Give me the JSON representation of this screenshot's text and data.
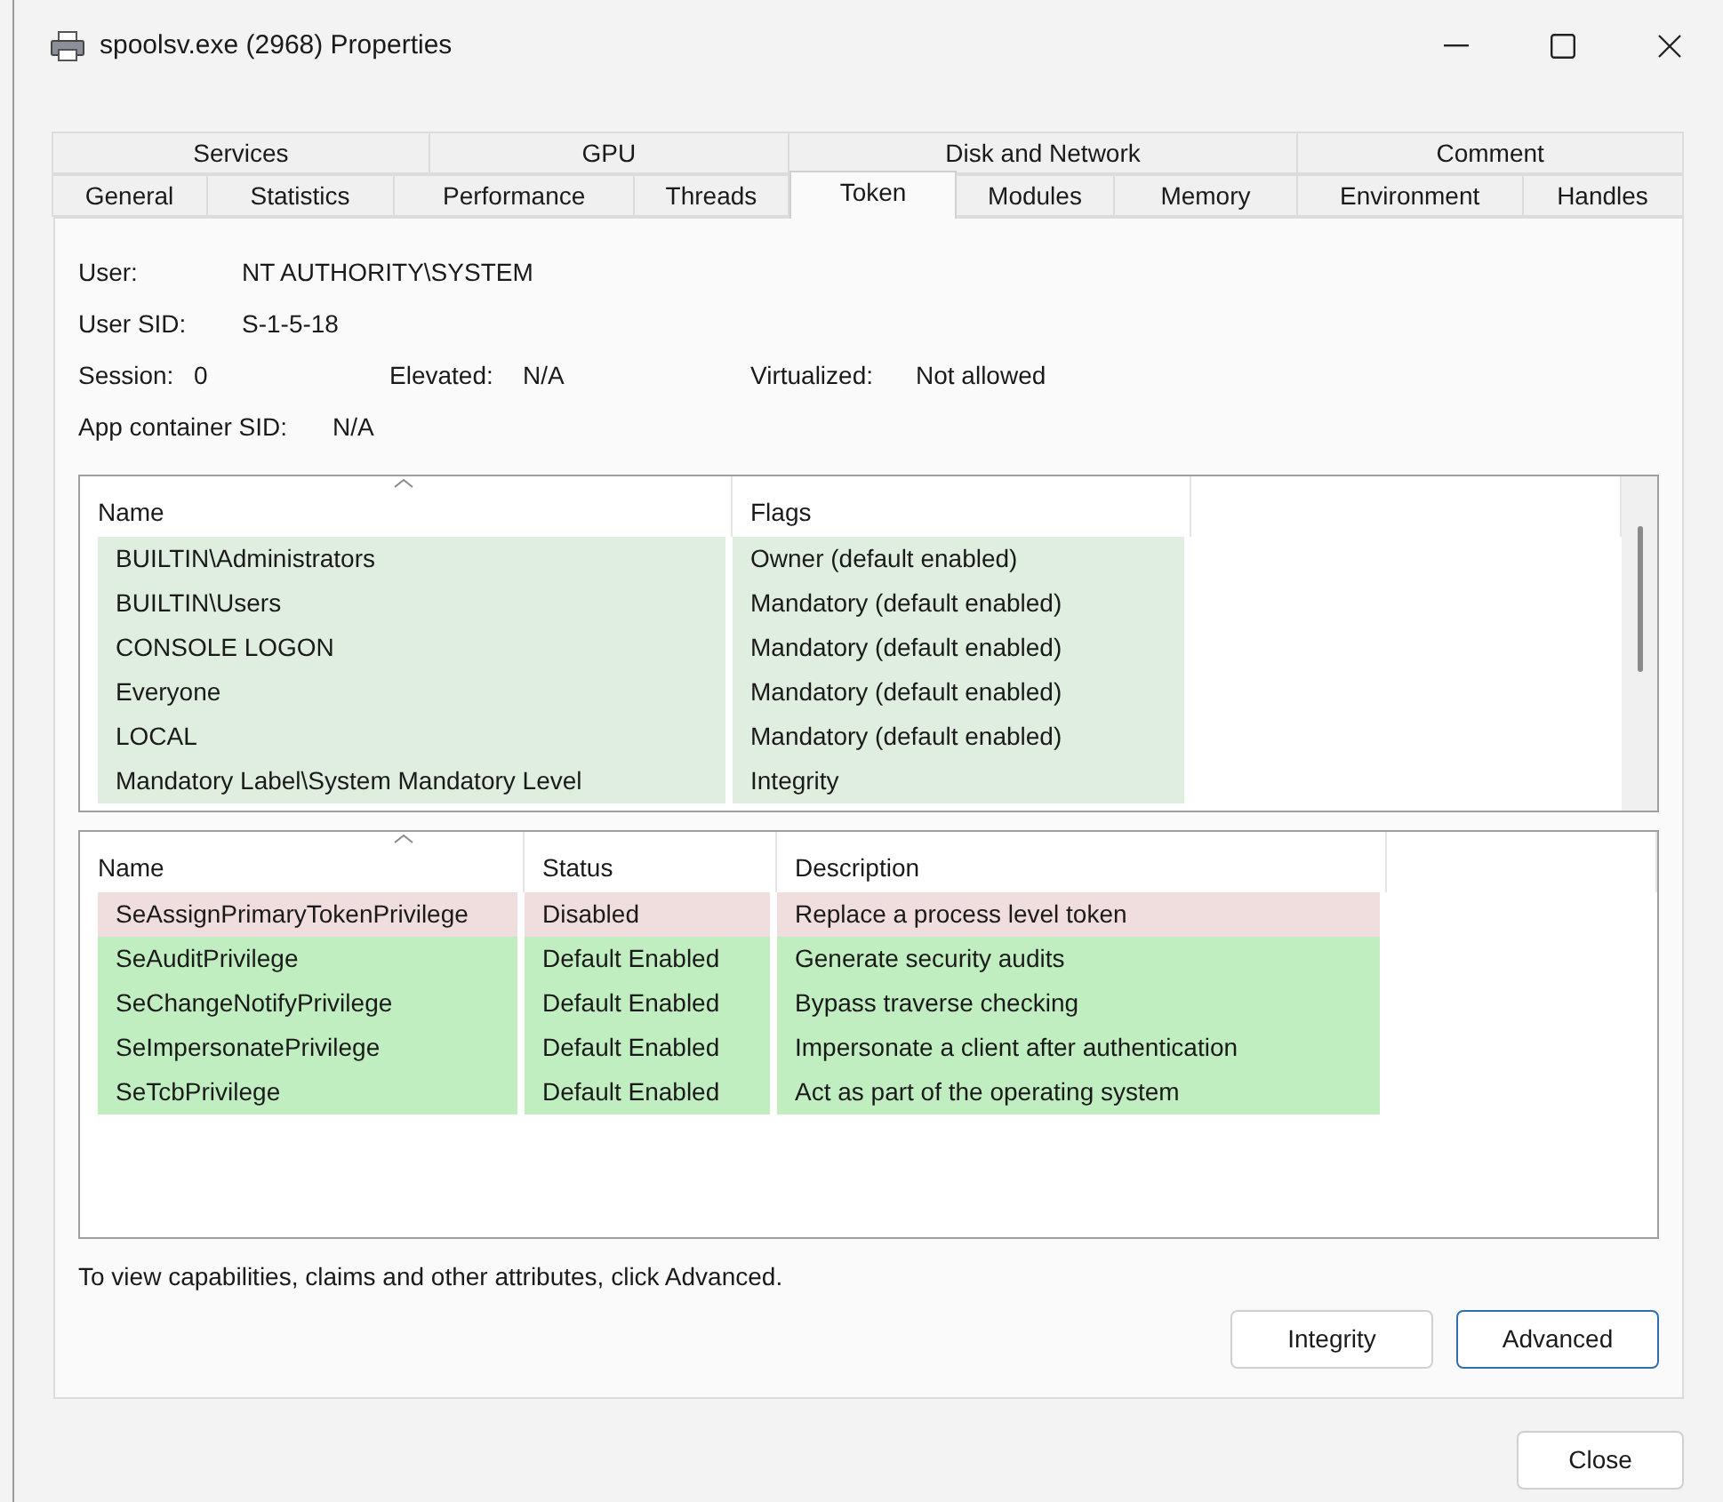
{
  "window": {
    "title": "spoolsv.exe (2968) Properties"
  },
  "tab_rows": [
    [
      {
        "label": "Services",
        "selected": false
      },
      {
        "label": "GPU",
        "selected": false
      },
      {
        "label": "Disk and Network",
        "selected": false
      },
      {
        "label": "Comment",
        "selected": false
      }
    ],
    [
      {
        "label": "General",
        "selected": false
      },
      {
        "label": "Statistics",
        "selected": false
      },
      {
        "label": "Performance",
        "selected": false
      },
      {
        "label": "Threads",
        "selected": false
      },
      {
        "label": "Token",
        "selected": true
      },
      {
        "label": "Modules",
        "selected": false
      },
      {
        "label": "Memory",
        "selected": false
      },
      {
        "label": "Environment",
        "selected": false
      },
      {
        "label": "Handles",
        "selected": false
      }
    ]
  ],
  "info": {
    "user_label": "User:",
    "user": "NT AUTHORITY\\SYSTEM",
    "sid_label": "User SID:",
    "sid": "S-1-5-18",
    "session_label": "Session:",
    "session": "0",
    "elevated_label": "Elevated:",
    "elevated": "N/A",
    "virtualized_label": "Virtualized:",
    "virtualized": "Not allowed",
    "app_container_label": "App container SID:",
    "app_container": "N/A"
  },
  "groups": {
    "columns": [
      "Name",
      "Flags"
    ],
    "rows": [
      {
        "name": "BUILTIN\\Administrators",
        "flags": "Owner (default enabled)",
        "color": "#dfeedf"
      },
      {
        "name": "BUILTIN\\Users",
        "flags": "Mandatory (default enabled)",
        "color": "#dfeedf"
      },
      {
        "name": "CONSOLE LOGON",
        "flags": "Mandatory (default enabled)",
        "color": "#dfeedf"
      },
      {
        "name": "Everyone",
        "flags": "Mandatory (default enabled)",
        "color": "#dfeedf"
      },
      {
        "name": "LOCAL",
        "flags": "Mandatory (default enabled)",
        "color": "#dfeedf"
      },
      {
        "name": "Mandatory Label\\System Mandatory Level",
        "flags": "Integrity",
        "color": "#dfeedf"
      }
    ]
  },
  "privileges": {
    "columns": [
      "Name",
      "Status",
      "Description"
    ],
    "rows": [
      {
        "name": "SeAssignPrimaryTokenPrivilege",
        "status": "Disabled",
        "description": "Replace a process level token",
        "color": "#f0dede"
      },
      {
        "name": "SeAuditPrivilege",
        "status": "Default Enabled",
        "description": "Generate security audits",
        "color": "#c0eec0"
      },
      {
        "name": "SeChangeNotifyPrivilege",
        "status": "Default Enabled",
        "description": "Bypass traverse checking",
        "color": "#c0eec0"
      },
      {
        "name": "SeImpersonatePrivilege",
        "status": "Default Enabled",
        "description": "Impersonate a client after authentication",
        "color": "#c0eec0"
      },
      {
        "name": "SeTcbPrivilege",
        "status": "Default Enabled",
        "description": "Act as part of the operating system",
        "color": "#c0eec0"
      }
    ]
  },
  "hint": "To view capabilities, claims and other attributes, click Advanced.",
  "buttons": [
    "Integrity",
    "Advanced"
  ],
  "close_button": "Close"
}
